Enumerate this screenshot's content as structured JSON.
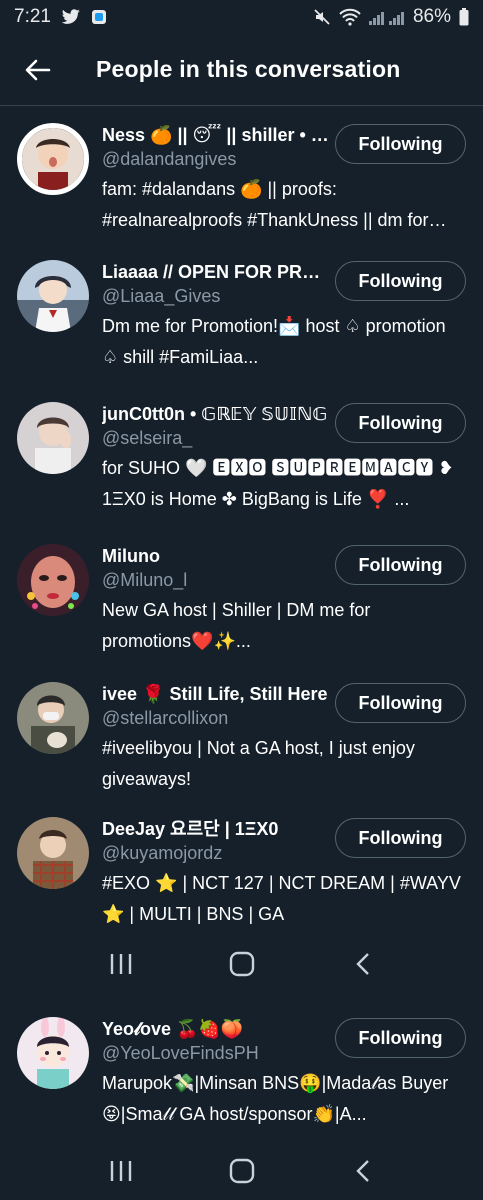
{
  "status_bar": {
    "time": "7:21",
    "battery": "86%"
  },
  "header": {
    "title": "People in this conversation"
  },
  "follow_label": "Following",
  "users": [
    {
      "name": "Ness 🍊 || 😴 || shiller • RT GA",
      "handle": "@dalandangives",
      "bio": "fam: #dalandans 🍊 || proofs: #realnarealproofs #ThankUness || dm for promo",
      "avatar_color": "#e8dcd2"
    },
    {
      "name": "Liaaaa // OPEN FOR PROMO",
      "handle": "@Liaaa_Gives",
      "bio": "Dm me for Promotion!📩 host ♤ promotion ♤ shill  #FamiLiaa...",
      "avatar_color": "#9fb3c8"
    },
    {
      "name": "junC0tt0n • 𝔾ℝ𝔼𝕐 𝕊𝕌𝕀ℕ𝔾",
      "handle": "@selseira_",
      "bio": "for SUHO 🤍 🅴🆇🅾 🆂🆄🅿🆁🅴🅼🅰🅲🆈 ❥ 1ΞX0 is Home ✤ BigBang is Life ❣️ ...",
      "avatar_color": "#d6d2d4"
    },
    {
      "name": "Miluno",
      "handle": "@Miluno_l",
      "bio": "New GA host | Shiller | DM me for promotions❤️✨...",
      "avatar_color": "#7a4a5c"
    },
    {
      "name": "ivee 🌹 Still Life, Still Here",
      "handle": "@stellarcollixon",
      "bio": "#iveelibyou | Not a GA host, I just enjoy giveaways!",
      "avatar_color": "#8a8b7c"
    },
    {
      "name": "DeeJay 요르단 | 1ΞX0",
      "handle": "@kuyamojordz",
      "bio": "#EXO ⭐ | NCT 127 | NCT DREAM | #WAYV ⭐ | MULTI | BNS | GA",
      "avatar_color": "#a08a72"
    },
    {
      "name": "Yeo𝓁ove 🍒🍓🍑",
      "handle": "@YeoLoveFindsPH",
      "bio": "Marupok💸|Minsan BNS🤑|Mada𝓁as Buyer😝|Sma𝓁𝓁 GA host/sponsor👏|A...",
      "avatar_color": "#f1e9ef"
    }
  ]
}
